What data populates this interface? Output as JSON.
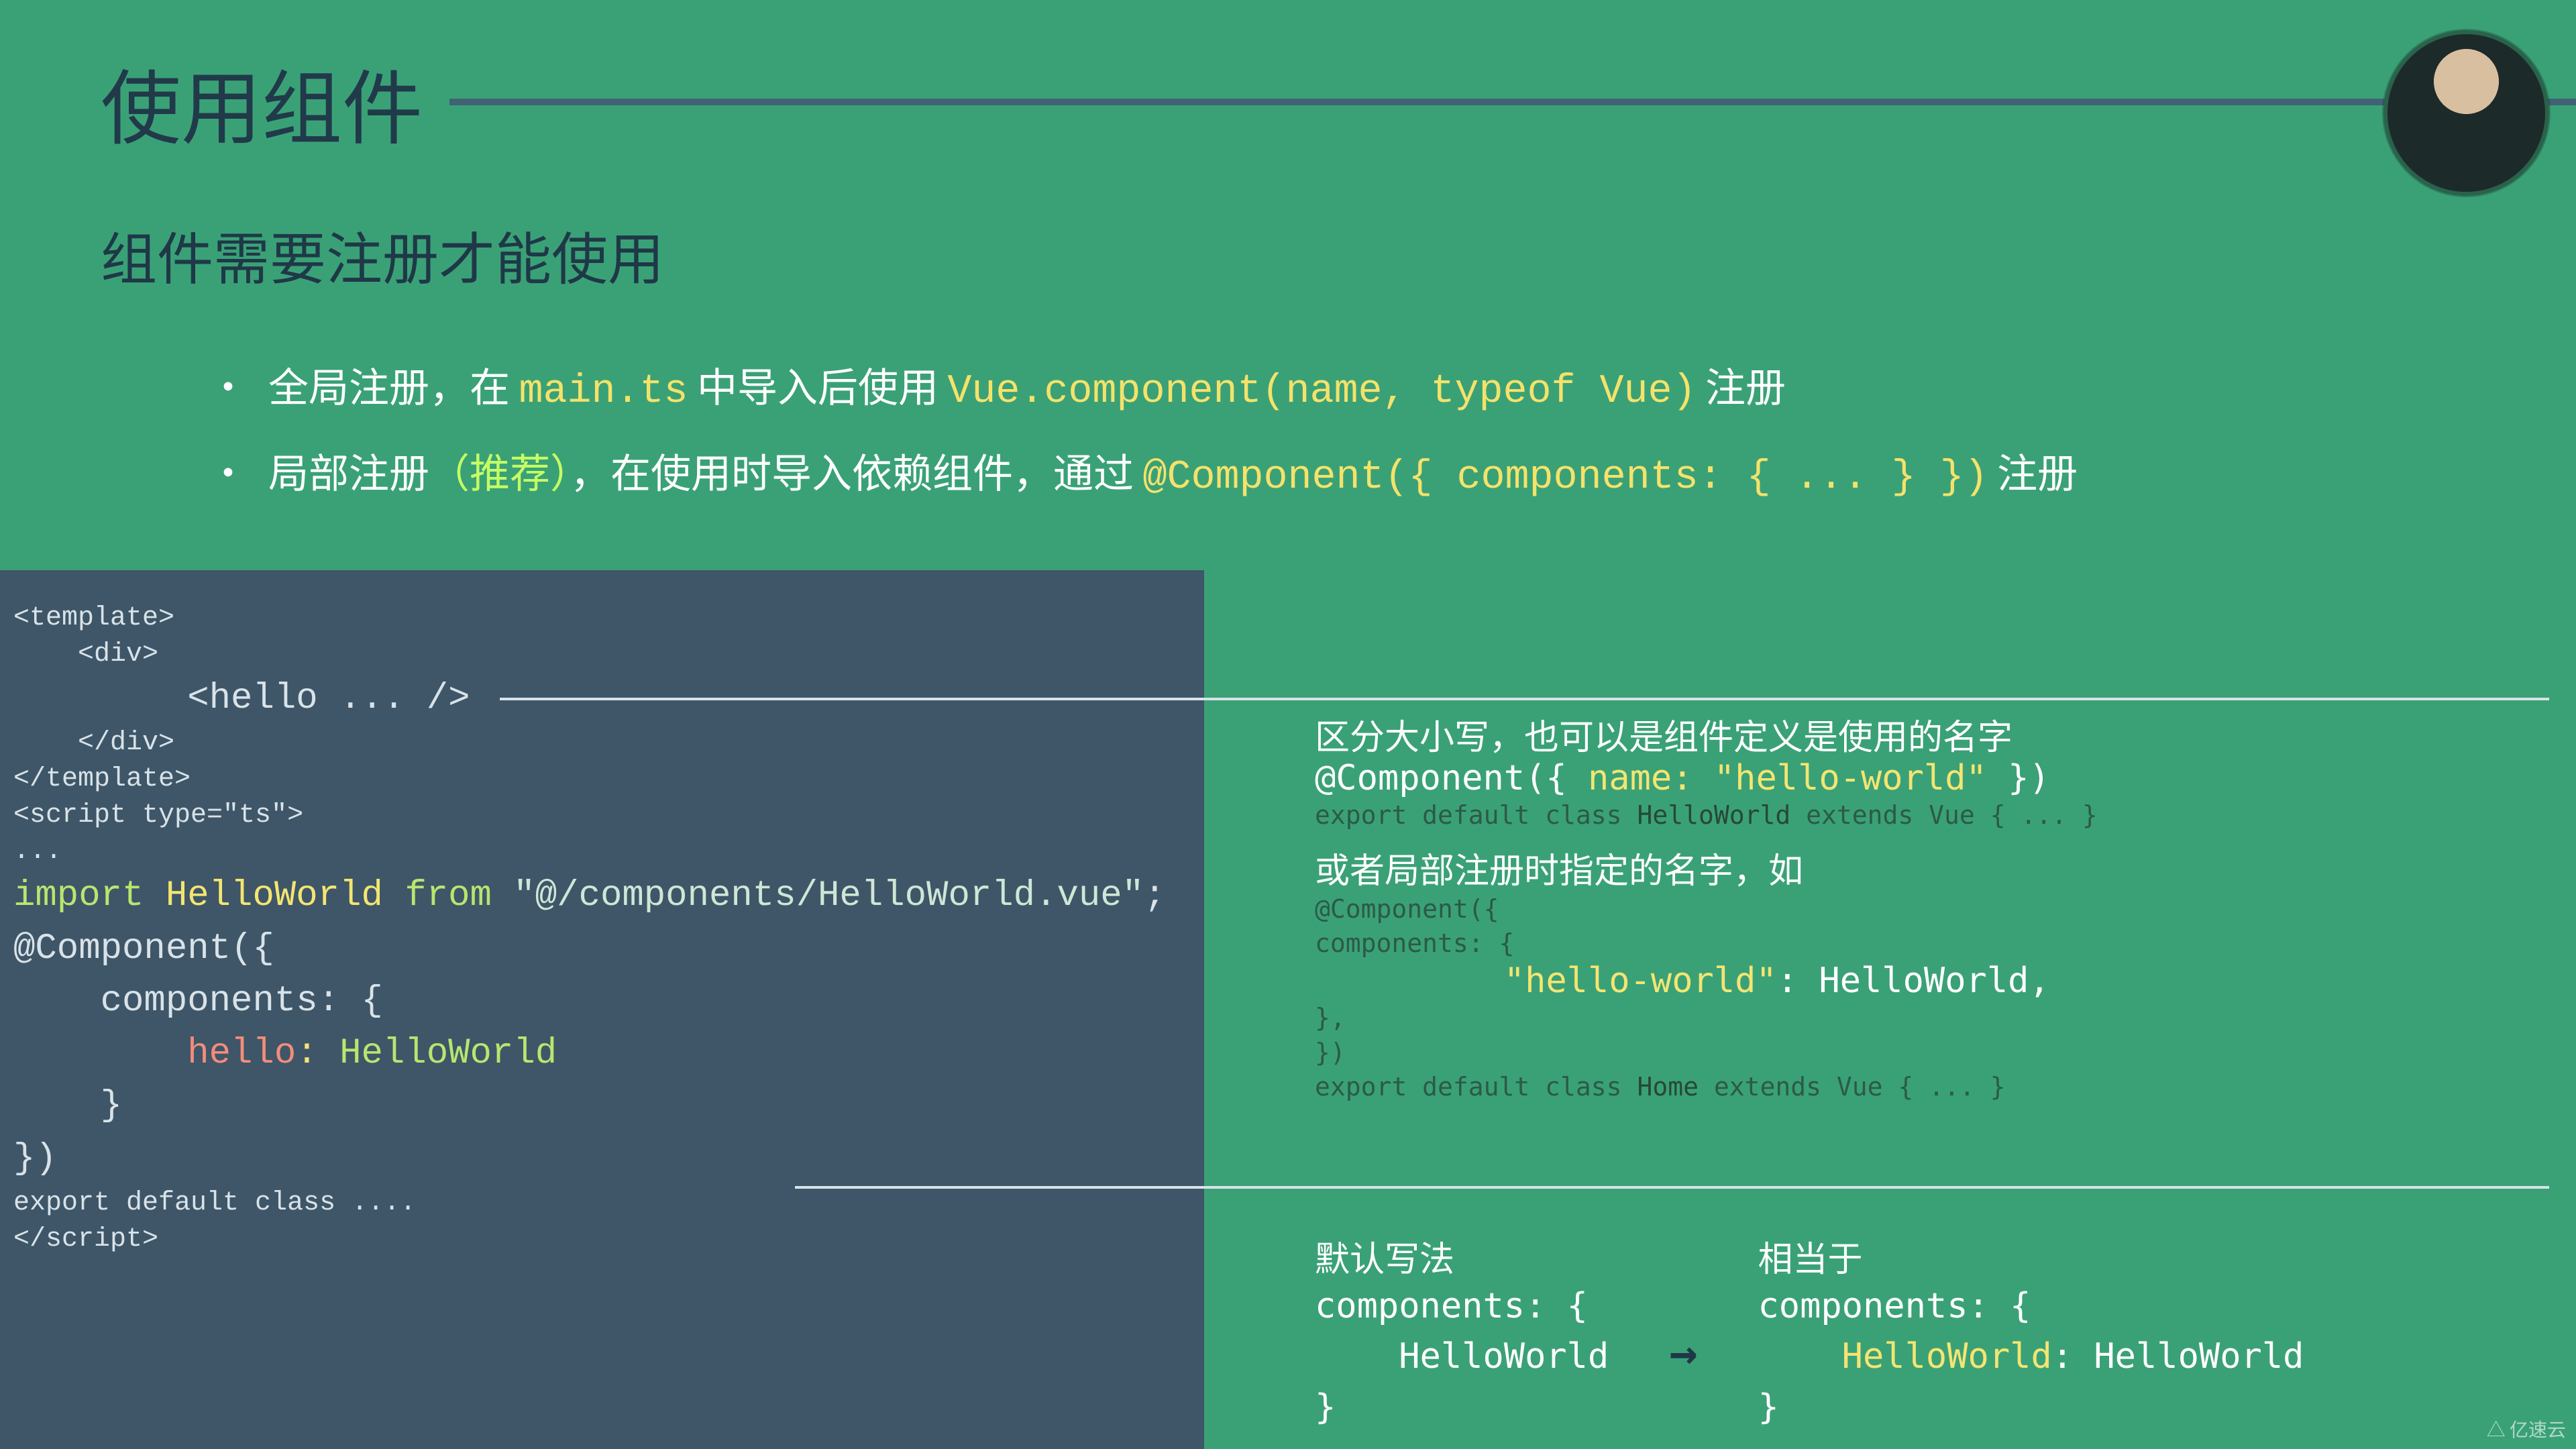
{
  "title": "使用组件",
  "subtitle": "组件需要注册才能使用",
  "bullets": {
    "b1_pre": "全局注册，在 ",
    "b1_code1": "main.ts",
    "b1_mid": " 中导入后使用 ",
    "b1_code2": "Vue.component(name, typeof Vue)",
    "b1_post": " 注册",
    "b2_pre": "局部注册",
    "b2_rec": "（推荐）",
    "b2_mid": "，在使用时导入依赖组件，通过 ",
    "b2_code": "@Component({ components: { ... } })",
    "b2_post": " 注册"
  },
  "code": {
    "l1": "<template>",
    "l2": "    <div>",
    "l3": "        <hello ... />",
    "l4": "    </div>",
    "l5": "</template>",
    "l6": "",
    "l7": "<script type=\"ts\">",
    "l8": "...",
    "l9a": "import",
    "l9b": " HelloWorld ",
    "l9c": "from",
    "l9d": " \"@/components/HelloWorld.vue\"",
    "l9e": ";",
    "l10": "",
    "l11": "@Component({",
    "l12": "    components: {",
    "l13a": "        hello",
    "l13b": ": ",
    "l13c": "HelloWorld",
    "l14": "    }",
    "l15": "})",
    "l16": "export default class ....",
    "l17": "</script>"
  },
  "right1": {
    "cap1": "区分大小写，也可以是组件定义是使用的名字",
    "deco1_a": "@Component({ ",
    "deco1_b": "name: \"hello-world\"",
    "deco1_c": " })",
    "sub1": "export default class HelloWorld extends Vue { ... }",
    "cap2": "或者局部注册时指定的名字，如",
    "c2l1": "@Component({",
    "c2l2": "    components: {",
    "c2l3a": "        \"hello-world\"",
    "c2l3b": ": HelloWorld,",
    "c2l4": "    },",
    "c2l5": "})",
    "sub2": "export default class Home extends Vue { ... }"
  },
  "right2": {
    "cap_left": "默认写法",
    "left_l1": "components: {",
    "left_l2": "    HelloWorld",
    "left_l3": "}",
    "arrow": "→",
    "cap_right": "相当于",
    "right_l1": "components: {",
    "right_l2a": "    HelloWorld",
    "right_l2b": ": HelloWorld",
    "right_l3": "}"
  },
  "watermark": "△ 亿速云"
}
